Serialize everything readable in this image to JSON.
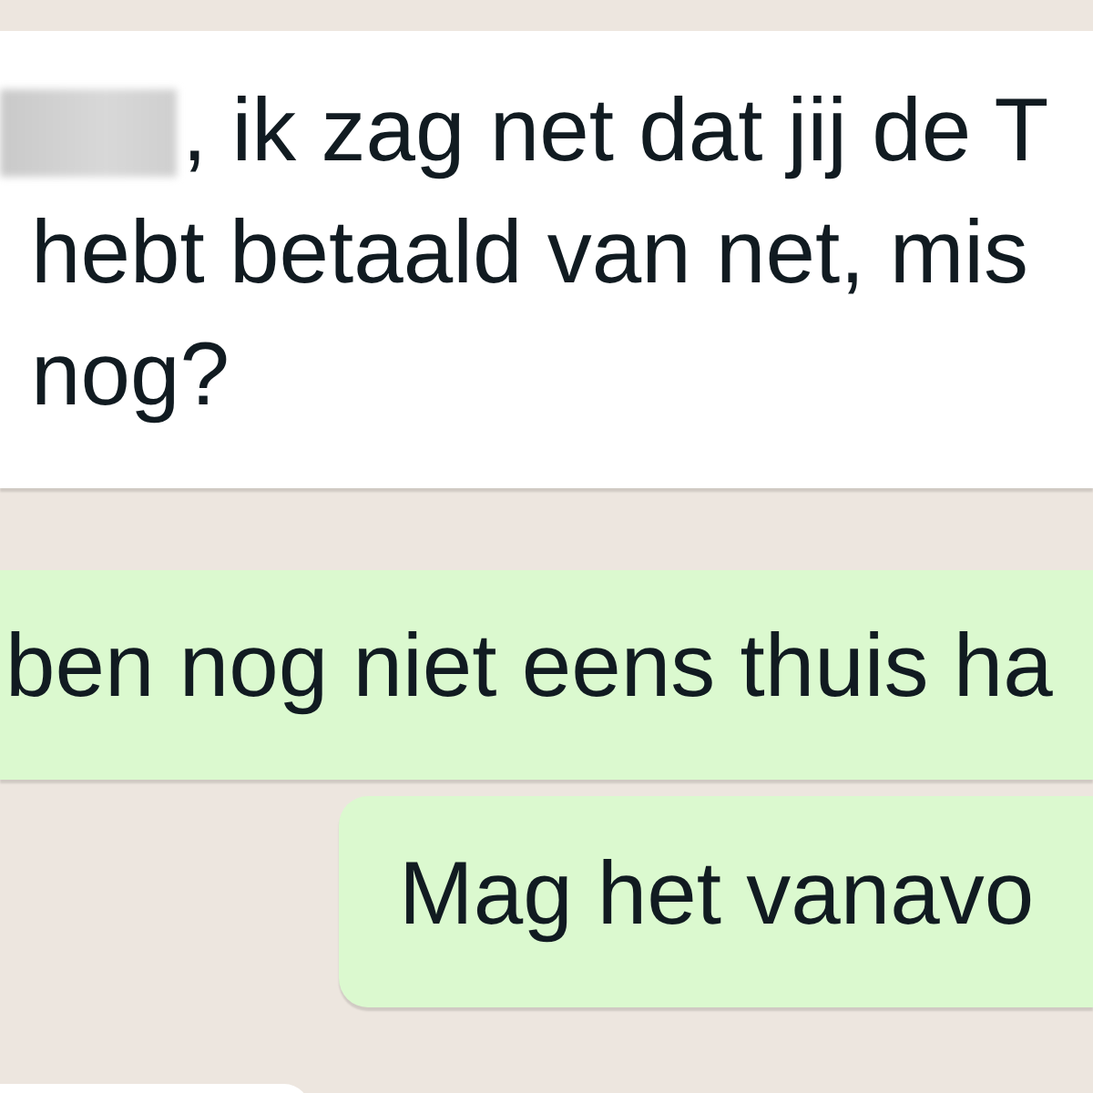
{
  "messages": [
    {
      "kind": "incoming",
      "lines": [
        {
          "text": ", ik zag net dat jij de T",
          "redacted": true
        },
        {
          "text": "hebt betaald van net, mis",
          "redacted": false
        },
        {
          "text": "nog?",
          "redacted": false
        }
      ]
    },
    {
      "kind": "outgoing",
      "lines": [
        {
          "text": "ben nog niet eens thuis ha",
          "redacted": false
        }
      ]
    },
    {
      "kind": "outgoing",
      "lines": [
        {
          "text": "Mag het vanavo",
          "redacted": false
        }
      ]
    },
    {
      "kind": "incoming"
    }
  ]
}
